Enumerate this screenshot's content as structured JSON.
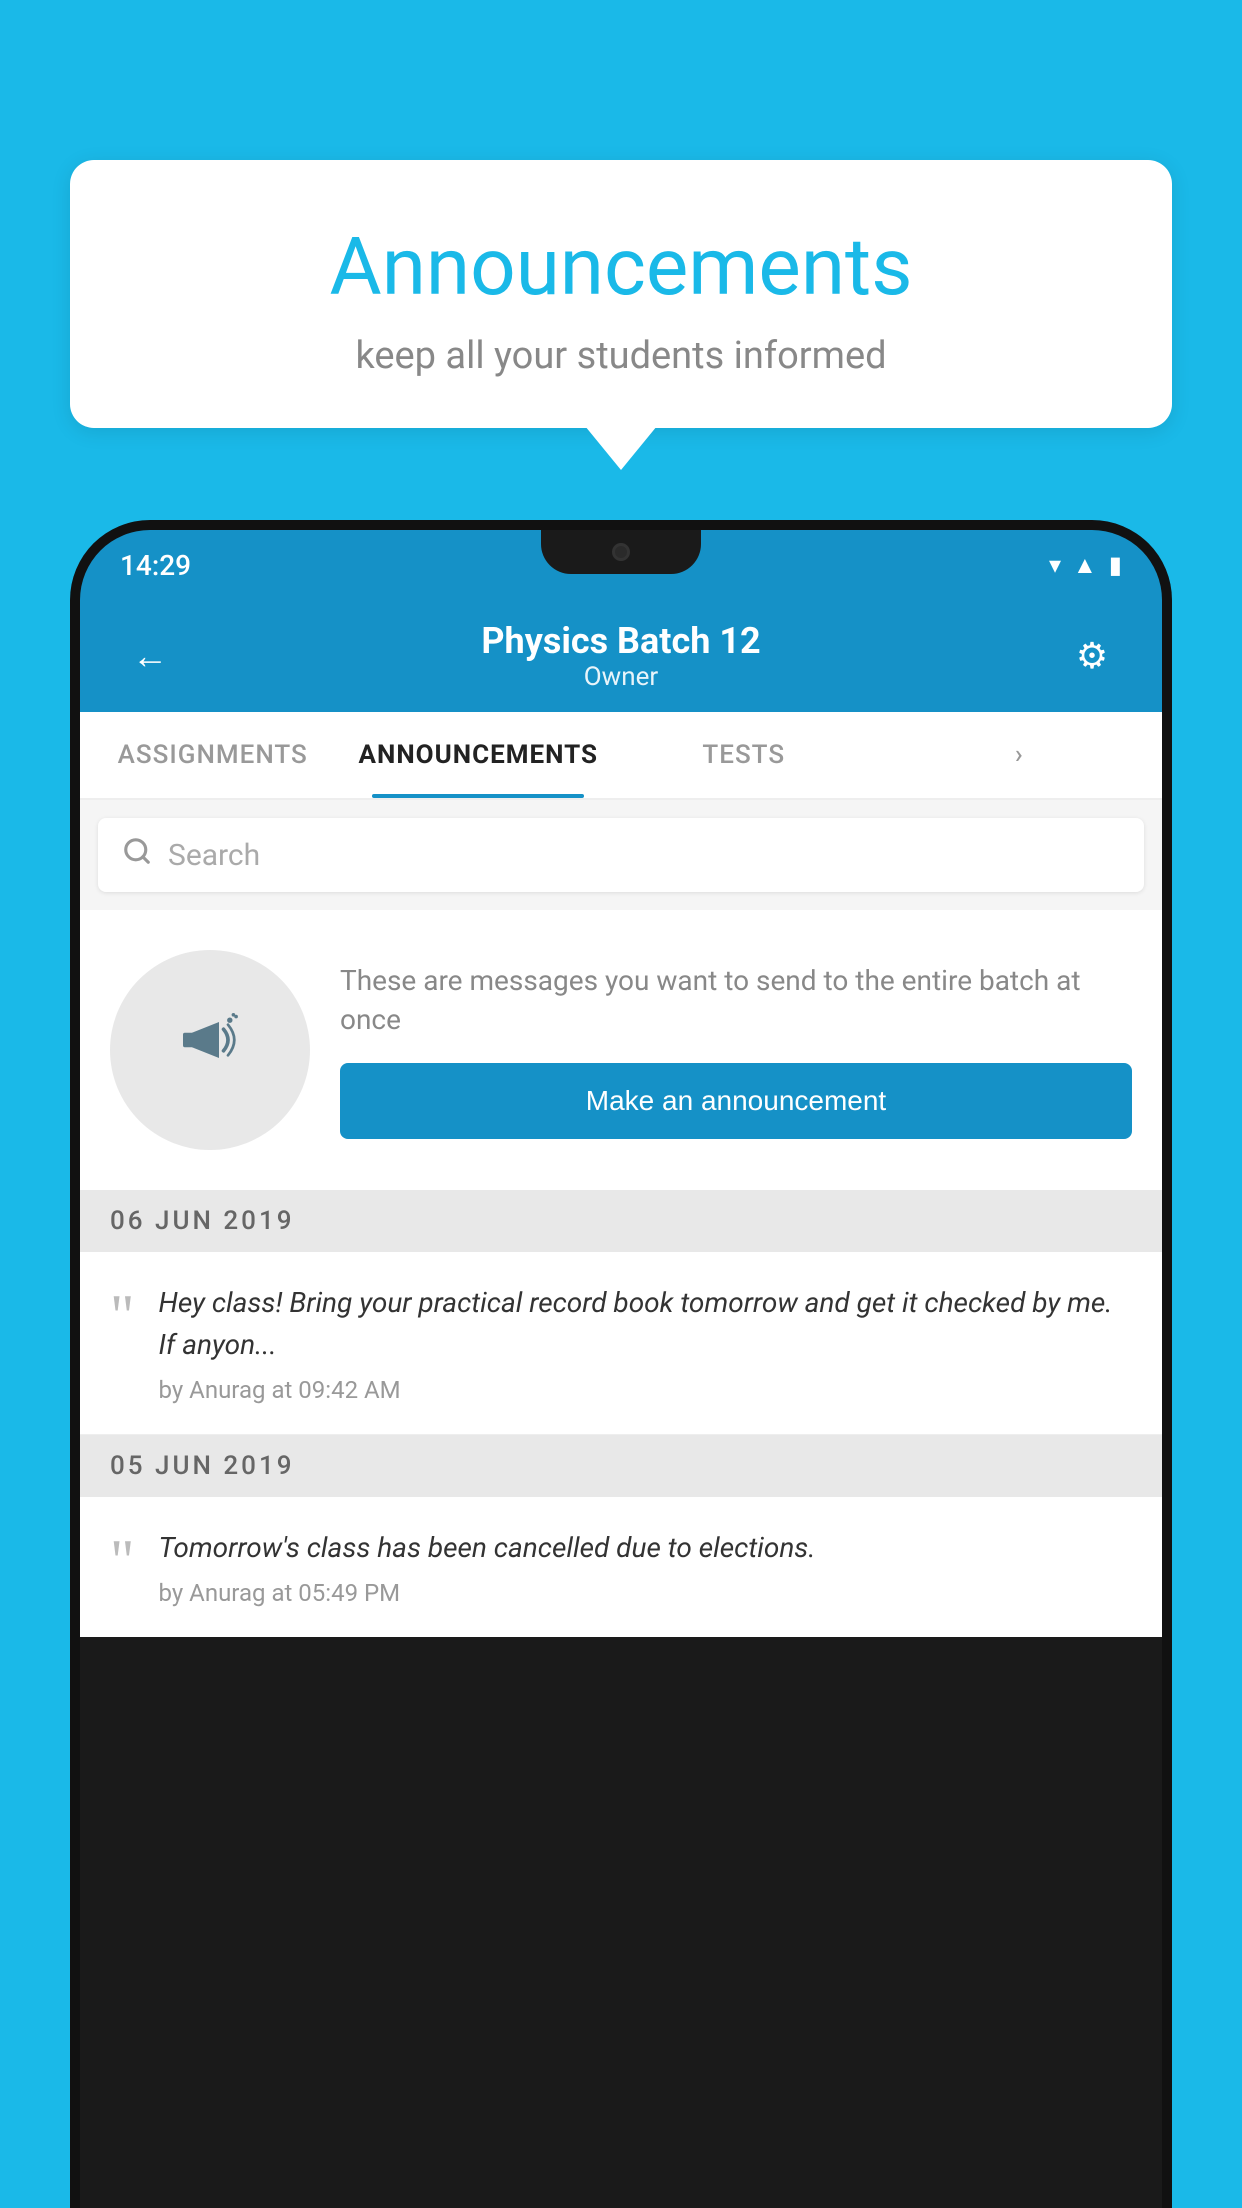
{
  "background": {
    "color": "#1ab9e8"
  },
  "speech_bubble": {
    "title": "Announcements",
    "subtitle": "keep all your students informed"
  },
  "phone": {
    "status_bar": {
      "time": "14:29",
      "wifi_icon": "▾",
      "signal_icon": "◂",
      "battery_icon": "▮"
    },
    "header": {
      "back_icon": "←",
      "title": "Physics Batch 12",
      "subtitle": "Owner",
      "gear_icon": "⚙"
    },
    "tabs": [
      {
        "label": "ASSIGNMENTS",
        "active": false
      },
      {
        "label": "ANNOUNCEMENTS",
        "active": true
      },
      {
        "label": "TESTS",
        "active": false
      },
      {
        "label": "›",
        "active": false
      }
    ],
    "search": {
      "placeholder": "Search"
    },
    "promo": {
      "description": "These are messages you want to send to the entire batch at once",
      "button_label": "Make an announcement"
    },
    "announcements": [
      {
        "date": "06  JUN  2019",
        "text": "Hey class! Bring your practical record book tomorrow and get it checked by me. If anyon...",
        "meta": "by Anurag at 09:42 AM"
      },
      {
        "date": "05  JUN  2019",
        "text": "Tomorrow's class has been cancelled due to elections.",
        "meta": "by Anurag at 05:49 PM"
      }
    ]
  }
}
